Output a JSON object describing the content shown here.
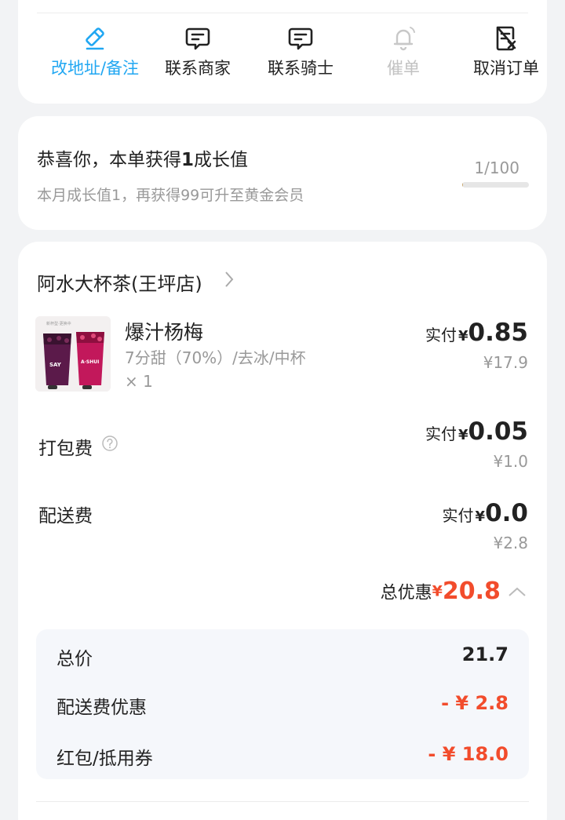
{
  "actions": [
    {
      "label": "改地址/备注",
      "icon": "edit-icon",
      "state": "active"
    },
    {
      "label": "联系商家",
      "icon": "chat-icon",
      "state": "normal"
    },
    {
      "label": "联系骑士",
      "icon": "chat-icon",
      "state": "normal"
    },
    {
      "label": "催单",
      "icon": "bell-icon",
      "state": "disabled"
    },
    {
      "label": "取消订单",
      "icon": "cancel-order-icon",
      "state": "normal"
    }
  ],
  "growth": {
    "title_prefix": "恭喜你，本单获得",
    "title_value": "1",
    "title_suffix": "成长值",
    "subtitle": "本月成长值1，再获得99可升至黄金会员",
    "progress_text": "1/100",
    "progress_fraction": 0.01
  },
  "order": {
    "shop_name": "阿水大杯茶(王坪店)",
    "product": {
      "name": "爆汁杨梅",
      "spec": "7分甜（70%）/去冰/中杯",
      "qty": "× 1",
      "paid_label": "实付",
      "currency": "¥",
      "paid_amount": "0.85",
      "original_price": "¥17.9"
    },
    "packing_fee": {
      "label": "打包费",
      "paid_label": "实付",
      "currency": "¥",
      "paid_amount": "0.05",
      "original_price": "¥1.0"
    },
    "delivery_fee": {
      "label": "配送费",
      "paid_label": "实付",
      "currency": "¥",
      "paid_amount": "0.0",
      "original_price": "¥2.8"
    },
    "total_discount": {
      "label": "总优惠",
      "currency": "¥",
      "amount": "20.8"
    },
    "breakdown": [
      {
        "label": "总价",
        "value": "21.7"
      },
      {
        "label": "配送费优惠",
        "value": "- ¥ 2.8"
      },
      {
        "label": "红包/抵用券",
        "value": "- ¥ 18.0"
      }
    ]
  },
  "colors": {
    "accent": "#21a7f2",
    "discount_red": "#f24c2c",
    "progress_gold": "#c9a66b"
  }
}
